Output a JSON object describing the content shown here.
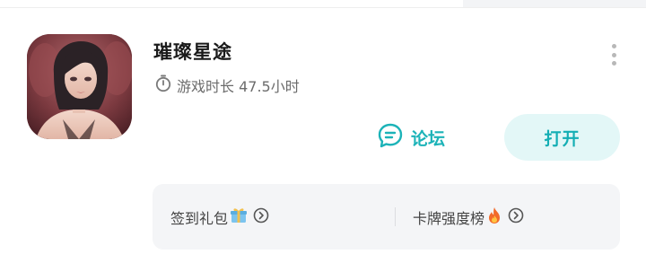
{
  "game": {
    "title": "璀璨星途",
    "playtime_label": "游戏时长 47.5小时"
  },
  "actions": {
    "forum_label": "论坛",
    "open_label": "打开"
  },
  "quick_links": [
    {
      "label": "签到礼包",
      "icon": "gift-icon"
    },
    {
      "label": "卡牌强度榜",
      "icon": "fire-icon"
    }
  ],
  "colors": {
    "accent": "#1cb3b8",
    "open_button_bg": "#e3f7f7",
    "quick_links_bg": "#f4f5f7"
  }
}
